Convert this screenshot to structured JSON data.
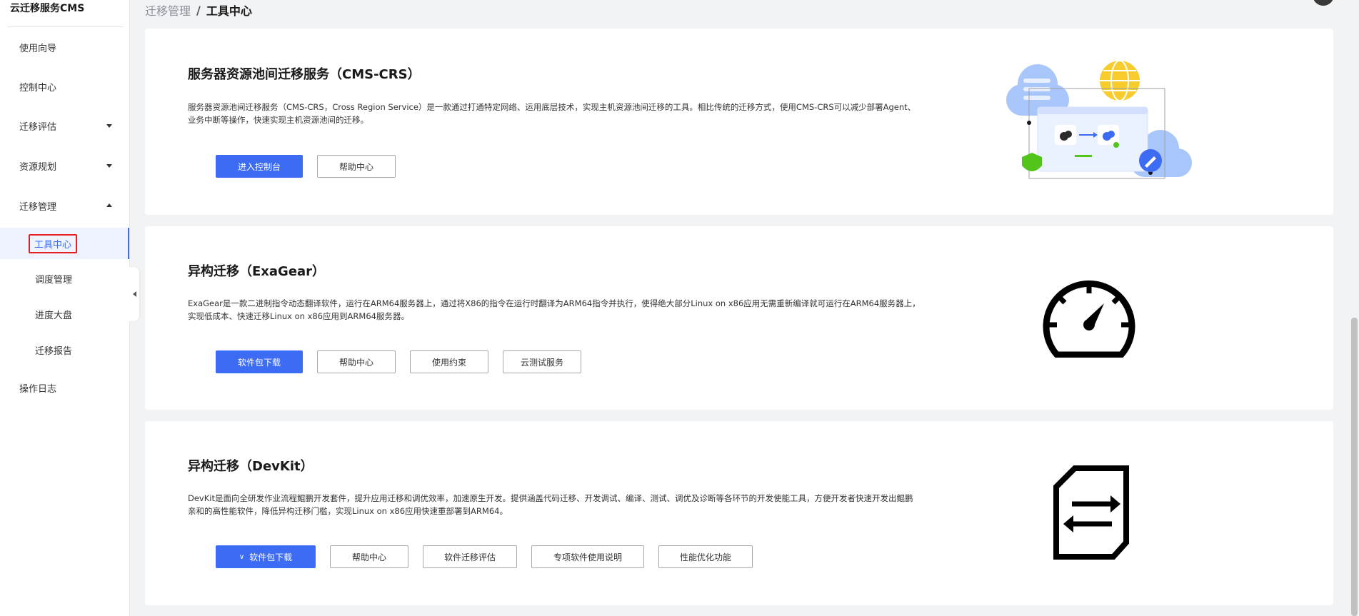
{
  "app": {
    "title": "云迁移服务CMS"
  },
  "sidebar": {
    "items": [
      {
        "label": "使用向导"
      },
      {
        "label": "控制中心"
      },
      {
        "label": "迁移评估"
      },
      {
        "label": "资源规划"
      },
      {
        "label": "迁移管理"
      },
      {
        "label": "操作日志"
      }
    ],
    "subitems": [
      {
        "label": "工具中心"
      },
      {
        "label": "调度管理"
      },
      {
        "label": "进度大盘"
      },
      {
        "label": "迁移报告"
      }
    ]
  },
  "breadcrumb": {
    "parent": "迁移管理",
    "separator": "/",
    "current": "工具中心"
  },
  "cards": [
    {
      "title": "服务器资源池间迁移服务（CMS-CRS）",
      "desc_line1": "服务器资源池间迁移服务（CMS-CRS，Cross Region Service）是一款通过打通特定网络、运用底层技术，实现主机资源池间迁移的工具。相比传统的迁移方式，使用CMS-CRS可以减少部署Agent、",
      "desc_line2": "业务中断等操作，快速实现主机资源池间的迁移。",
      "buttons": [
        "进入控制台",
        "帮助中心"
      ]
    },
    {
      "title": "异构迁移（ExaGear）",
      "desc_line1": "ExaGear是一款二进制指令动态翻译软件，运行在ARM64服务器上，通过将X86的指令在运行时翻译为ARM64指令并执行，使得绝大部分Linux on x86应用无需重新编译就可运行在ARM64服务器上，",
      "desc_line2": "实现低成本、快速迁移Linux on x86应用到ARM64服务器。",
      "buttons": [
        "软件包下载",
        "帮助中心",
        "使用约束",
        "云测试服务"
      ]
    },
    {
      "title": "异构迁移（DevKit）",
      "desc_line1": "DevKit是面向全研发作业流程鲲鹏开发套件，提升应用迁移和调优效率，加速原生开发。提供涵盖代码迁移、开发调试、编译、测试、调优及诊断等各环节的开发使能工具，方便开发者快速开发出鲲鹏",
      "desc_line2": "亲和的高性能软件，降低异构迁移门槛，实现Linux on x86应用快速重部署到ARM64。",
      "buttons": [
        "软件包下载",
        "帮助中心",
        "软件迁移评估",
        "专项软件使用说明",
        "性能优化功能"
      ]
    }
  ],
  "colors": {
    "primary": "#3c6bf4",
    "highlight_border": "#e62020",
    "page_bg": "#f2f3f5"
  },
  "icons": [
    "chevron-down-icon",
    "chevron-up-icon",
    "collapse-left-icon",
    "cloud-migration-illustration",
    "speedometer-icon",
    "document-exchange-icon"
  ]
}
